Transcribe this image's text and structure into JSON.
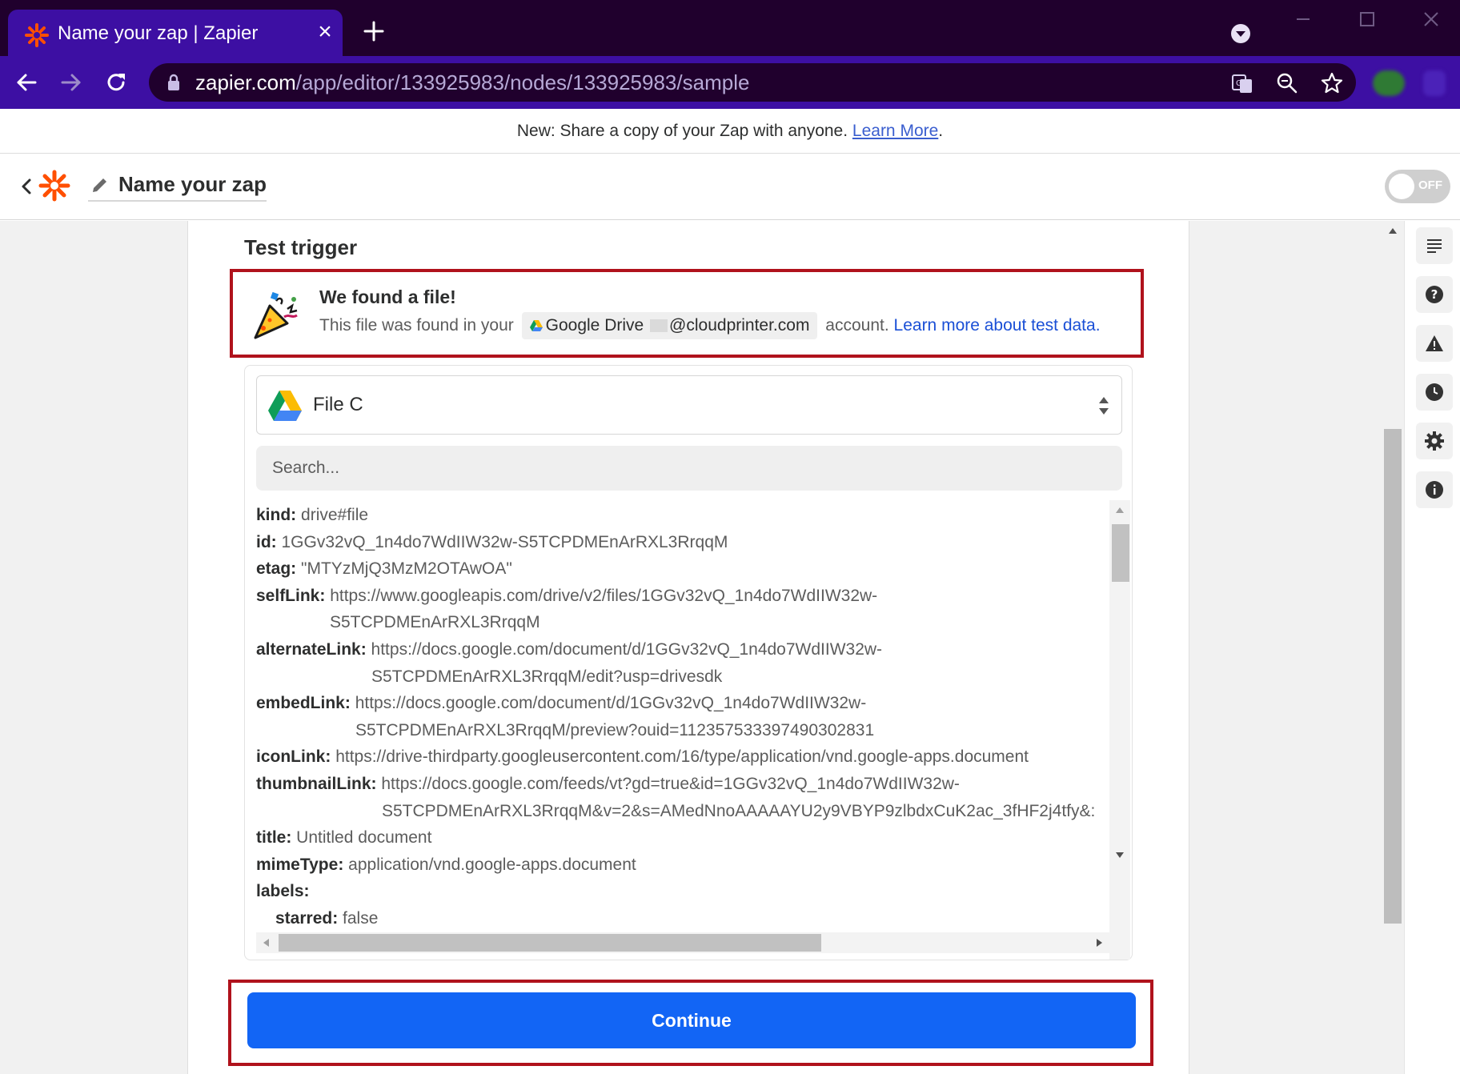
{
  "browser": {
    "tab_title": "Name your zap | Zapier",
    "url_host": "zapier.com",
    "url_path": "/app/editor/133925983/nodes/133925983/sample"
  },
  "announcement": {
    "text": "New: Share a copy of your Zap with anyone. ",
    "link": "Learn More",
    "suffix": "."
  },
  "header": {
    "zap_name": "Name your zap",
    "toggle_label": "OFF"
  },
  "test_trigger": {
    "title": "Test trigger",
    "found_title": "We found a file!",
    "found_prefix": "This file was found in your",
    "account_app": "Google Drive",
    "account_email": "@cloudprinter.com",
    "found_suffix": "account.",
    "learn_link": "Learn more about test data."
  },
  "record": {
    "selected_file": "File C",
    "search_placeholder": "Search...",
    "fields": [
      {
        "key": "kind:",
        "value": "drive#file"
      },
      {
        "key": "id:",
        "value": "1GGv32vQ_1n4do7WdIIW32w-S5TCPDMEnArRXL3RrqqM"
      },
      {
        "key": "etag:",
        "value": "\"MTYzMjQ3MzM2OTAwOA\""
      },
      {
        "key": "selfLink:",
        "value": "https://www.googleapis.com/drive/v2/files/1GGv32vQ_1n4do7WdIIW32w-",
        "cont": "S5TCPDMEnArRXL3RrqqM"
      },
      {
        "key": "alternateLink:",
        "value": "https://docs.google.com/document/d/1GGv32vQ_1n4do7WdIIW32w-",
        "cont": "S5TCPDMEnArRXL3RrqqM/edit?usp=drivesdk"
      },
      {
        "key": "embedLink:",
        "value": "https://docs.google.com/document/d/1GGv32vQ_1n4do7WdIIW32w-",
        "cont": "S5TCPDMEnArRXL3RrqqM/preview?ouid=112357533397490302831"
      },
      {
        "key": "iconLink:",
        "value": "https://drive-thirdparty.googleusercontent.com/16/type/application/vnd.google-apps.document"
      },
      {
        "key": "thumbnailLink:",
        "value": "https://docs.google.com/feeds/vt?gd=true&id=1GGv32vQ_1n4do7WdIIW32w-",
        "cont": "S5TCPDMEnArRXL3RrqqM&v=2&s=AMedNnoAAAAAYU2y9VBYP9zlbdxCuK2ac_3fHF2j4tfy&:"
      },
      {
        "key": "title:",
        "value": "Untitled document"
      },
      {
        "key": "mimeType:",
        "value": "application/vnd.google-apps.document"
      },
      {
        "key": "labels:",
        "value": ""
      },
      {
        "key": "starred:",
        "value": "false",
        "nested": true
      }
    ]
  },
  "continue_label": "Continue",
  "colors": {
    "brand_orange": "#ff4f00",
    "primary_blue": "#1265f5",
    "highlight_red": "#b0121c",
    "chrome_dark": "#20002d",
    "chrome_purple": "#3d0fa3"
  },
  "icons": [
    "zapier-favicon",
    "close-icon",
    "plus-icon",
    "back-arrow-icon",
    "forward-arrow-icon",
    "reload-icon",
    "lock-icon",
    "translate-icon",
    "zoom-icon",
    "star-icon",
    "chevron-left-icon",
    "pencil-icon",
    "party-popper-icon",
    "google-drive-icon",
    "sort-arrows-icon",
    "notes-icon",
    "help-icon",
    "warning-icon",
    "history-icon",
    "settings-icon",
    "info-icon"
  ]
}
